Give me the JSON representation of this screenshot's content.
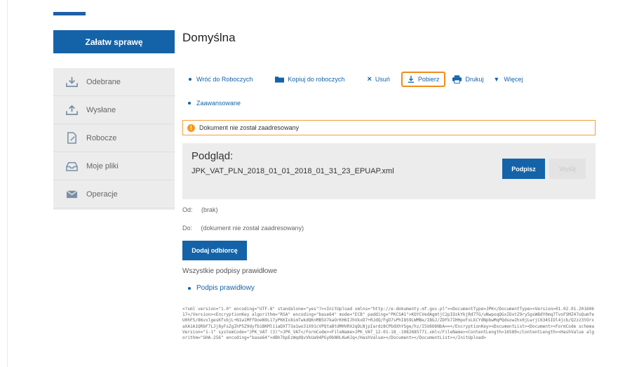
{
  "sidebar": {
    "primary_button": "Załatw sprawę",
    "items": [
      {
        "label": "Odebrane",
        "icon": "inbox-download-icon"
      },
      {
        "label": "Wysłane",
        "icon": "outbox-upload-icon"
      },
      {
        "label": "Robocze",
        "icon": "draft-document-icon"
      },
      {
        "label": "Moje pliki",
        "icon": "tray-icon"
      },
      {
        "label": "Operacje",
        "icon": "envelope-icon"
      }
    ]
  },
  "main": {
    "title": "Domyślna",
    "toolbar": {
      "back": "Wróć do Roboczych",
      "copy": "Kopiuj do roboczych",
      "delete": "Usuń",
      "download": "Pobierz",
      "print": "Drukuj",
      "more": "Więcej"
    },
    "advanced": "Zaawansowane",
    "warning": "Dokument nie został zaadresowany",
    "preview": {
      "title": "Podgląd:",
      "filename": "JPK_VAT_PLN_2018_01_01_2018_01_31_23_EPUAP.xml",
      "sign_button": "Podpisz",
      "send_button": "Wyślij"
    },
    "from_label": "Od:",
    "from_value": "(brak)",
    "to_label": "Do:",
    "to_value": "(dokument nie został zaadresowany)",
    "add_recipient": "Dodaj odbiorcę",
    "signatures_all": "Wszystkie podpisy prawidłowe",
    "signature_ok": "Podpis prawidłowy",
    "xml_content": "<?xml version=\"1.0\" encoding=\"UTF-8\" standalone=\"yes\"?><InitUpload xmlns=\"http://e-dokumenty.mf.gov.pl\"><DocumentType>JPK</DocumentType><Version>01.02.01.20160617</Version><EncryptionKey algorithm=\"RSA\" encoding=\"base64\" mode=\"ECB\" padding=\"PKCS#1\">KOYCVedAgmtjC2pIOzkYkjRd7TG/uNwpoqQGxIDxtZ9ry5gsW8dY0mq7TvoFSMZ47oQumfeU0hF5/86vxlgesKfxbjL+N1w1MFfDoeN9L17yPKKIx8imTwkdQKnMB5X7kaOrKH6IJhVkxD7+RJdQ/FgD7sPhI8S9LWMBe/IBGJ/ZDFk7IHHpoFxLkCYdNpbwMqPQdsow2hx0jLwrjC634SIOl4jcb/Q2zz3tOrxaXA1A1QRbF7LJj8yFsZgIhP5Z9dyfb1BKMl11aDXT73a1wo31X91cVPQtaBtdMHVRX2qDLNjpIardz8CPbdXhYSge/hz/I5U6O6NbA==</EncryptionKey><DocumentList><Document><FormCode schemaVersion=\"1-1\" systemCode=\"JPK_VAT (3)\">JPK_VAT</FormCode><FileName>JPK_VAT_12-01-18_-1082685771.xml</FileName><ContentLength>16589</ContentLength><HashValue algorithm=\"SHA-256\" encoding=\"base64\">dBh7bpEzWqdQvVkUa94PGy0bN0LKw0Jq</HashValue></Document></DocumentList></InitUpload>"
  },
  "colors": {
    "accent": "#1463a8",
    "highlight": "#f08c1e",
    "warning": "#f59a23"
  }
}
